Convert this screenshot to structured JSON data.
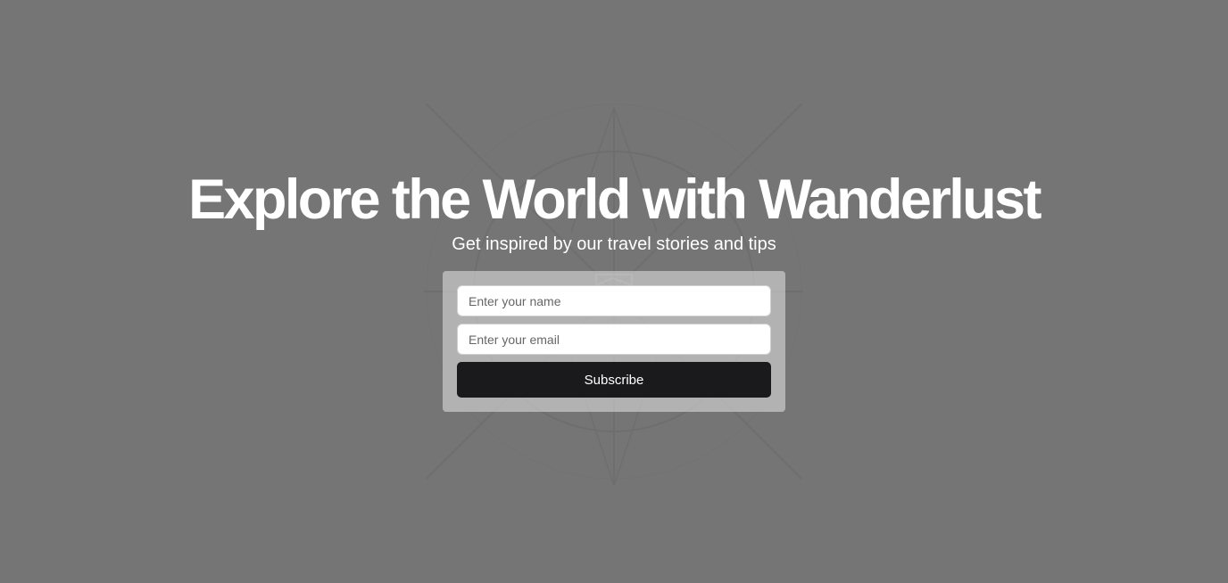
{
  "hero": {
    "title": "Explore the World with Wanderlust",
    "subtitle": "Get inspired by our travel stories and tips"
  },
  "signup_form": {
    "name_field": {
      "placeholder": "Enter your name",
      "value": ""
    },
    "email_field": {
      "placeholder": "Enter your email",
      "value": ""
    },
    "submit_label": "Subscribe"
  },
  "colors": {
    "page_background": "#757575",
    "heading_text": "#ffffff",
    "card_background": "#b9b9b9",
    "button_background": "#1a1a1c",
    "button_text": "#ffffff"
  },
  "icons": {
    "background_decoration": "compass-rose-icon"
  }
}
